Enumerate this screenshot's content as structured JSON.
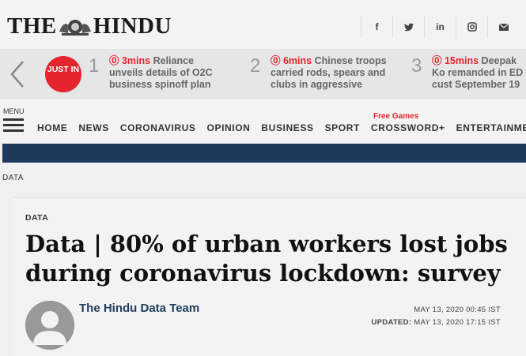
{
  "header": {
    "logo_left": "THE",
    "logo_right": "HINDU",
    "social": [
      {
        "icon": "facebook-icon",
        "glyph": "f"
      },
      {
        "icon": "twitter-icon",
        "glyph": "✈"
      },
      {
        "icon": "linkedin-icon",
        "glyph": "in"
      },
      {
        "icon": "instagram-icon",
        "glyph": "▣"
      },
      {
        "icon": "email-icon",
        "glyph": "✉"
      }
    ]
  },
  "justin": {
    "badge": "JUST IN",
    "items": [
      {
        "num": "1",
        "time": "⓪ 3mins",
        "text": "Reliance unveils details of O2C business spinoff plan"
      },
      {
        "num": "2",
        "time": "⓪ 6mins",
        "text": "Chinese troops carried rods, spears and clubs in aggressive"
      },
      {
        "num": "3",
        "time": "⓪ 15mins",
        "text": "Deepak Ko remanded in ED cust September 19"
      }
    ]
  },
  "nav": {
    "menu_label": "MENU",
    "free_games": "Free Games",
    "items": [
      "HOME",
      "NEWS",
      "CORONAVIRUS",
      "OPINION",
      "BUSINESS",
      "SPORT",
      "CROSSWORD+",
      "ENTERTAINMENT"
    ]
  },
  "breadcrumb": "DATA",
  "article": {
    "section": "DATA",
    "headline": "Data | 80% of urban workers lost jobs during coronavirus lockdown: survey",
    "author": "The Hindu Data Team",
    "published": "MAY 13, 2020 00:45 IST",
    "updated_label": "UPDATED:",
    "updated": "MAY 13, 2020 17:15 IST"
  },
  "colors": {
    "accent_red": "#e4252e",
    "navy": "#1e3a5a"
  }
}
